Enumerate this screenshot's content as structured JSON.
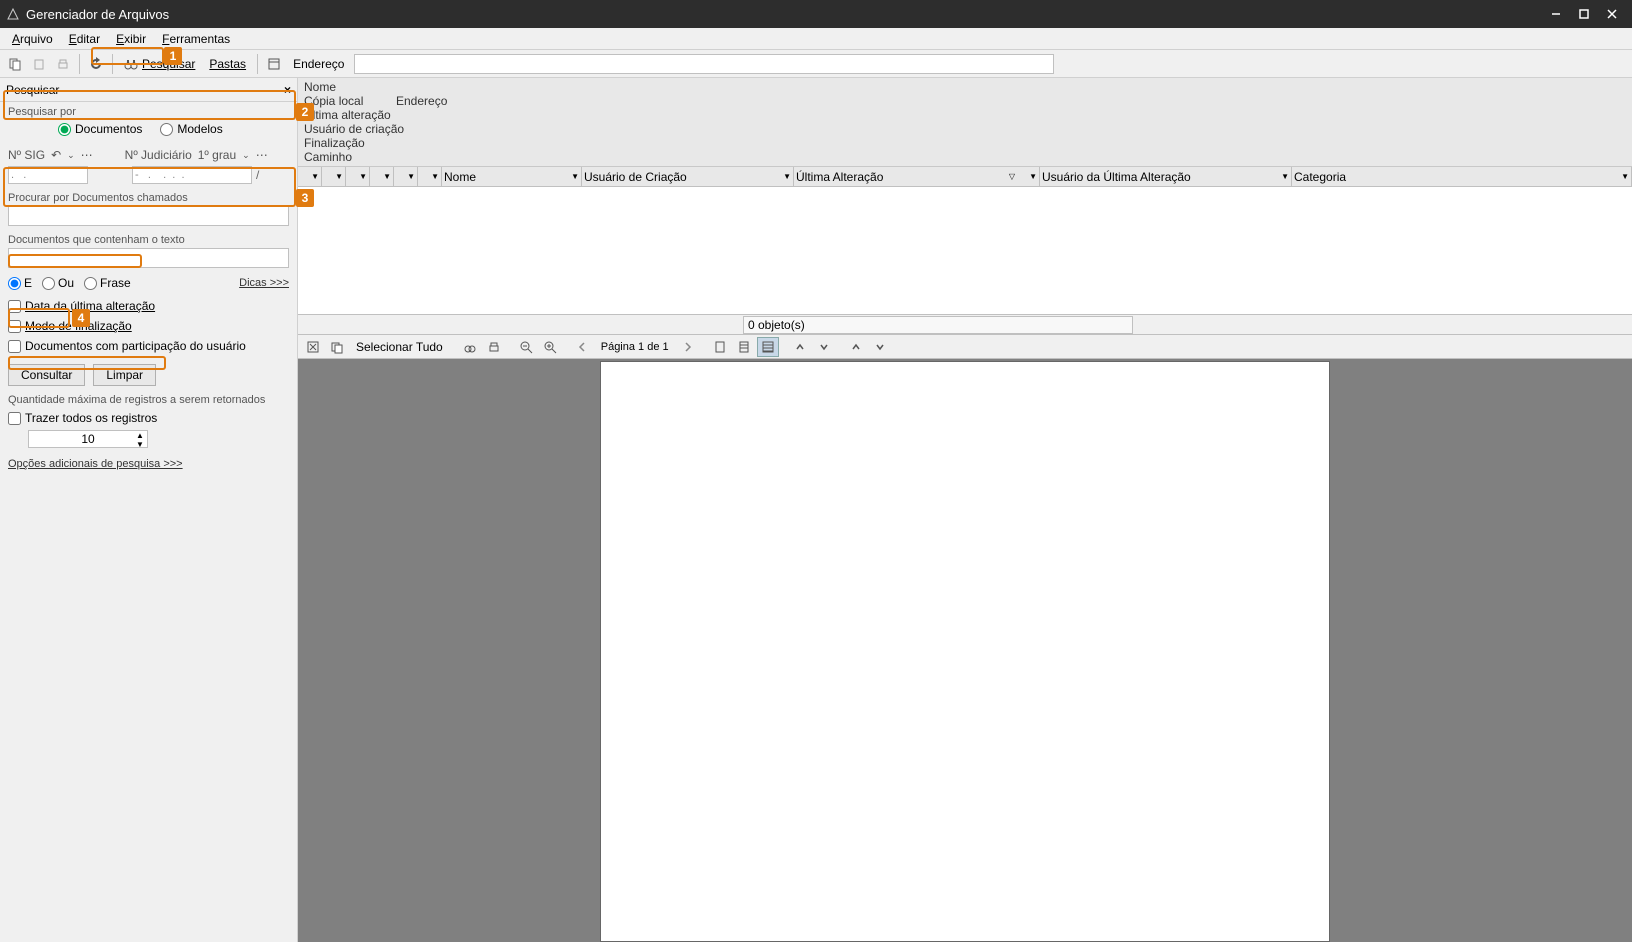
{
  "window": {
    "title": "Gerenciador de Arquivos"
  },
  "menu": {
    "arquivo": "Arquivo",
    "editar": "Editar",
    "exibir": "Exibir",
    "ferramentas": "Ferramentas"
  },
  "toolbar": {
    "pesquisar": "Pesquisar",
    "pastas": "Pastas",
    "endereco": "Endereço"
  },
  "searchpanel": {
    "header": "Pesquisar",
    "pesquisar_por": "Pesquisar por",
    "documentos": "Documentos",
    "modelos": "Modelos",
    "nsig": "Nº SIG",
    "njud": "Nº Judiciário",
    "grau": "1º grau",
    "sig_placeholder": ".   .",
    "jud_placeholder": "-   .    .  .  .",
    "slash": "/",
    "procurar_docs": "Procurar por Documentos chamados",
    "docs_texto": "Documentos que contenham o texto",
    "e": "E",
    "ou": "Ou",
    "frase": "Frase",
    "dicas": "Dicas >>>",
    "chk_data": "Data da última alteração",
    "chk_modo": "Modo de finalização",
    "chk_part": "Documentos com participação do usuário",
    "consultar": "Consultar",
    "limpar": "Limpar",
    "qtymax": "Quantidade máxima de registros a serem retornados",
    "chk_trazer": "Trazer todos os registros",
    "spin_value": "10",
    "opcoes": "Opções adicionais de pesquisa >>>"
  },
  "details": {
    "nome": "Nome",
    "copia": "Cópia local",
    "endereco": "Endereço",
    "ultalt": "Última alteração",
    "usucriacao": "Usuário de criação",
    "final": "Finalização",
    "caminho": "Caminho"
  },
  "filters": {
    "nome": "Nome",
    "uc": "Usuário de Criação",
    "ua": "Última Alteração",
    "uua": "Usuário da Última Alteração",
    "cat": "Categoria"
  },
  "status": {
    "objetos": "0 objeto(s)"
  },
  "viewer": {
    "selecionar": "Selecionar Tudo",
    "pagina": "Página 1 de 1"
  },
  "badges": {
    "b1": "1",
    "b2": "2",
    "b3": "3",
    "b4": "4"
  }
}
